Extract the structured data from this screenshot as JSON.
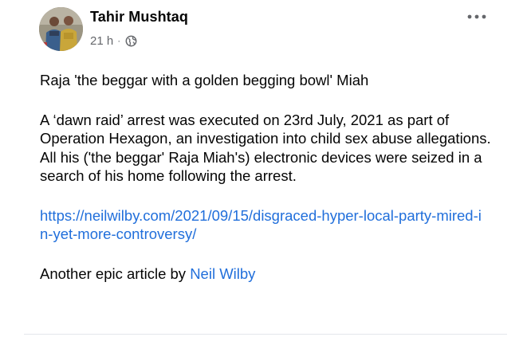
{
  "post": {
    "author": {
      "name": "Tahir Mushtaq",
      "avatar_icon": "profile-photo-two-people-icon"
    },
    "meta": {
      "time": "21 h",
      "separator": "·",
      "audience_icon": "globe-icon"
    },
    "more_icon": "more-options-icon",
    "title_line": "Raja 'the beggar with a golden begging bowl' Miah",
    "paragraph": "A ‘dawn raid’ arrest was executed on 23rd July, 2021 as part of Operation Hexagon, an investigation into child sex abuse allegations. All his ('the beggar' Raja Miah's) electronic devices were seized in a search of his home following the arrest.",
    "link": {
      "text": "https://neilwilby.com/2021/09/15/disgraced-hyper-local-party-mired-in-yet-more-controversy/"
    },
    "closing": {
      "prefix": "Another epic article by ",
      "mention": "Neil Wilby"
    },
    "colors": {
      "link": "#216fdb",
      "secondary_text": "#65676b",
      "primary_text": "#050505"
    }
  }
}
